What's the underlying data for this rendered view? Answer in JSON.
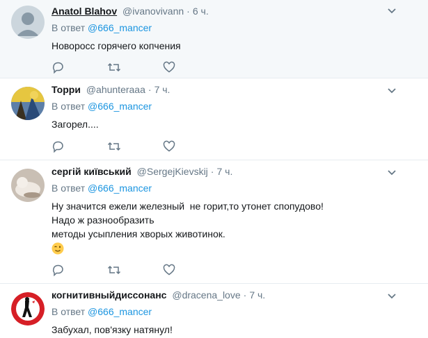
{
  "tweets": [
    {
      "name": "Anatol Blahov",
      "handle": "@ivanovivann",
      "time": "6 ч.",
      "reply_prefix": "В ответ",
      "reply_to": "@666_mancer",
      "lines": [
        "Новоросс горячего копчения"
      ]
    },
    {
      "name": "Торри",
      "handle": "@ahunteraaa",
      "time": "7 ч.",
      "reply_prefix": "В ответ",
      "reply_to": "@666_mancer",
      "lines": [
        "Загорел...."
      ]
    },
    {
      "name": "сергій київський",
      "handle": "@SergejKievskij",
      "time": "7 ч.",
      "reply_prefix": "В ответ",
      "reply_to": "@666_mancer",
      "lines": [
        "Ну значится ежели железный  не горит,то утонет спопудово!",
        "Надо ж разнообразить",
        "методы усыпления хворых животинок."
      ],
      "emoji": "wink-face"
    },
    {
      "name": "когнитивныйдиссонанс",
      "handle": "@dracena_love",
      "time": "7 ч.",
      "reply_prefix": "В ответ",
      "reply_to": "@666_mancer",
      "lines": [
        "Забухал, пов'язку натянул!"
      ]
    }
  ],
  "colors": {
    "accent": "#1b95e0",
    "muted": "#657786",
    "highlight_bg": "#f5f8fa",
    "divider": "#e6ecf0"
  },
  "icons": [
    "reply-icon",
    "retweet-icon",
    "like-icon",
    "chevron-down-icon"
  ]
}
